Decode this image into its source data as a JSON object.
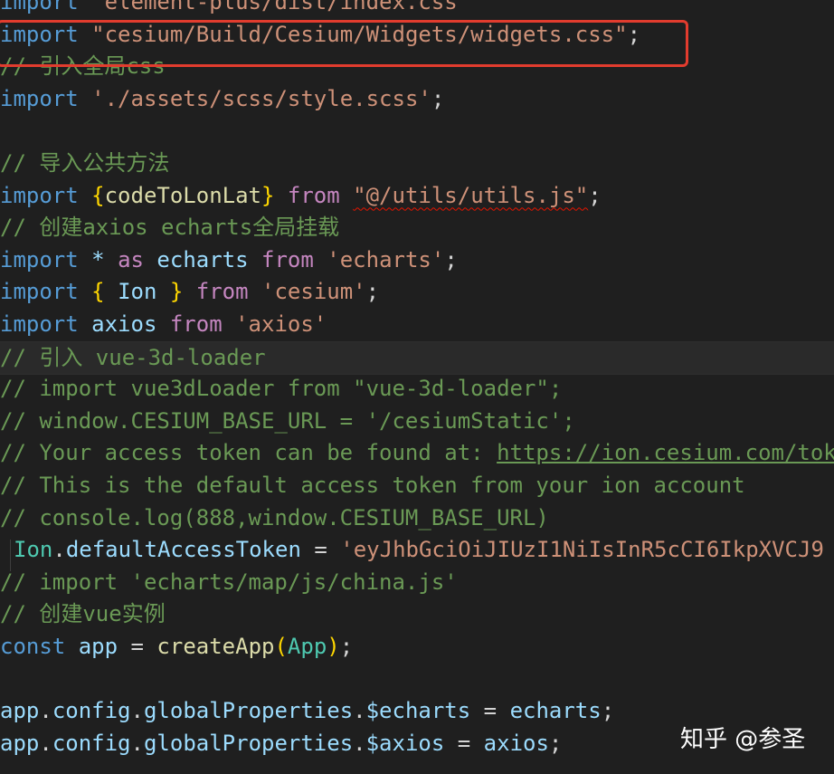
{
  "lines": [
    [
      "import",
      " ",
      "'element-plus/dist/index.css'"
    ],
    [
      "import",
      " ",
      "\"cesium/Build/Cesium/Widgets/widgets.css\"",
      ";"
    ],
    [
      "// 引入全局css"
    ],
    [
      "import",
      " ",
      "'./assets/scss/style.scss'",
      ";"
    ],
    [],
    [
      "// 导入公共方法"
    ],
    [
      "import",
      " ",
      "{",
      "codeToLonLat",
      "}",
      " ",
      "from",
      " ",
      "\"@/utils/utils.js\"",
      ";"
    ],
    [
      "// 创建axios echarts全局挂载"
    ],
    [
      "import",
      " ",
      "*",
      " ",
      "as",
      " ",
      "echarts",
      " ",
      "from",
      " ",
      "'echarts'",
      ";"
    ],
    [
      "import",
      " ",
      "{",
      " ",
      "Ion",
      " ",
      "}",
      " ",
      "from",
      " ",
      "'cesium'",
      ";"
    ],
    [
      "import",
      " ",
      "axios",
      " ",
      "from",
      " ",
      "'axios'"
    ],
    [
      "// 引入 vue-3d-loader"
    ],
    [
      "// import vue3dLoader from \"vue-3d-loader\";"
    ],
    [
      "// window.CESIUM_BASE_URL = '/cesiumStatic';"
    ],
    [
      "// Your access token can be found at: ",
      "https://ion.cesium.com/tokens"
    ],
    [
      "// This is the default access token from your ion account"
    ],
    [
      "// console.log(888,window.CESIUM_BASE_URL)"
    ],
    [
      "Ion",
      ".",
      "defaultAccessToken",
      " = ",
      "'eyJhbGciOiJIUzI1NiIsInR5cCI6IkpXVCJ9"
    ],
    [
      "// import 'echarts/map/js/china.js'"
    ],
    [
      "// 创建vue实例"
    ],
    [
      "const",
      " ",
      "app",
      " = ",
      "createApp",
      "(",
      "App",
      ")",
      ";"
    ],
    [],
    [
      "app",
      ".",
      "config",
      ".",
      "globalProperties",
      ".",
      "$echarts",
      " = ",
      "echarts",
      ";"
    ],
    [
      "app",
      ".",
      "config",
      ".",
      "globalProperties",
      ".",
      "$axios",
      " = ",
      "axios",
      ";"
    ]
  ],
  "colors": {
    "background": "#1f1f1f",
    "keyword": "#569cd6",
    "control_keyword": "#c586c0",
    "string": "#ce9178",
    "comment": "#6a9955",
    "variable": "#9cdcfe",
    "class": "#4ec9b0",
    "function": "#dcdcaa",
    "brace": "#ffd700",
    "highlight_box": "#e23c2e"
  },
  "watermark": "知乎 @参圣"
}
